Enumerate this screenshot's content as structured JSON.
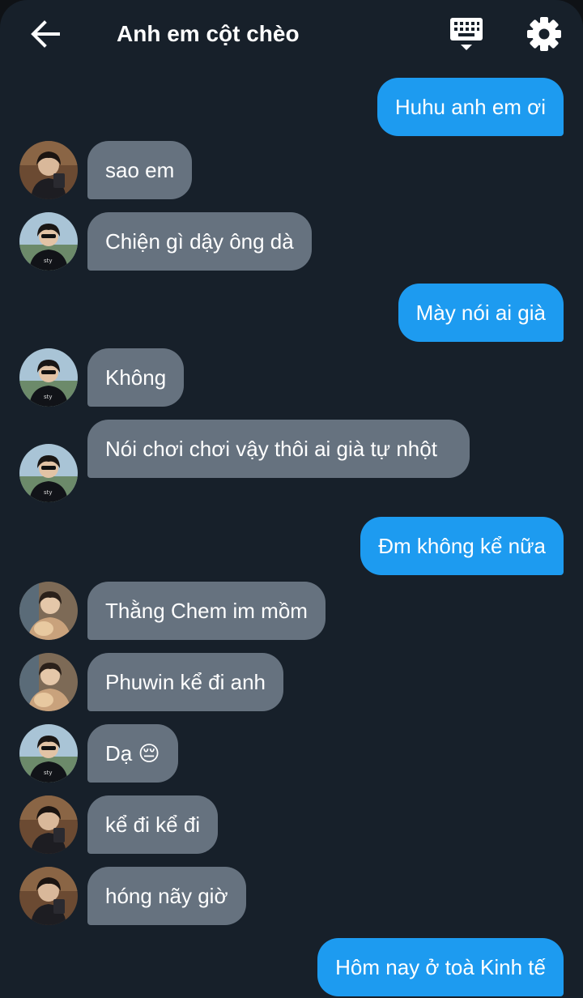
{
  "header": {
    "title": "Anh em cột chèo",
    "back_icon": "arrow-back-icon",
    "keyboard_icon": "keyboard-icon",
    "settings_icon": "gear-icon"
  },
  "colors": {
    "background": "#17202a",
    "incoming_bubble": "#66727f",
    "outgoing_bubble": "#1d9bf0",
    "text": "#ffffff"
  },
  "messages": [
    {
      "sender": "me",
      "text": "Huhu anh em ơi"
    },
    {
      "sender": "friend-a",
      "text": "sao em"
    },
    {
      "sender": "friend-b",
      "text": "Chiện gì dậy ông dà"
    },
    {
      "sender": "me",
      "text": "Mày nói ai già"
    },
    {
      "sender": "friend-b",
      "text": "Không"
    },
    {
      "sender": "friend-b",
      "text": "Nói chơi chơi vậy thôi ai già tự nhột"
    },
    {
      "sender": "me",
      "text": "Đm không kể nữa"
    },
    {
      "sender": "friend-c",
      "text": "Thằng Chem im mồm"
    },
    {
      "sender": "friend-c",
      "text": "Phuwin kể đi anh"
    },
    {
      "sender": "friend-b",
      "text": "Dạ 😔"
    },
    {
      "sender": "friend-a",
      "text": "kể đi kể đi"
    },
    {
      "sender": "friend-a",
      "text": "hóng nãy giờ"
    },
    {
      "sender": "me",
      "text": "Hôm nay ở toà Kinh tế"
    }
  ]
}
